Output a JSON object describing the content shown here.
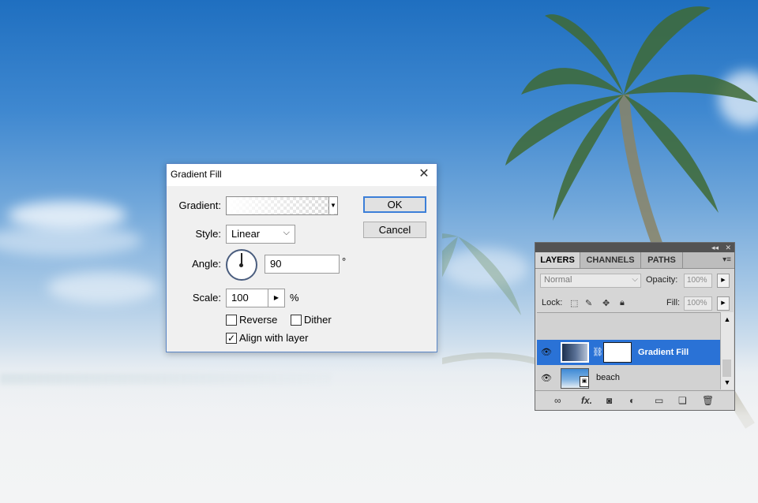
{
  "dialog": {
    "title": "Gradient Fill",
    "close_glyph": "✕",
    "gradient_label": "Gradient:",
    "style_label": "Style:",
    "style_value": "Linear",
    "angle_label": "Angle:",
    "angle_value": "90",
    "angle_unit": "°",
    "scale_label": "Scale:",
    "scale_value": "100",
    "scale_unit": "%",
    "reverse_label": "Reverse",
    "reverse_checked": false,
    "dither_label": "Dither",
    "dither_checked": false,
    "align_label": "Align with layer",
    "align_checked": true,
    "ok_label": "OK",
    "cancel_label": "Cancel"
  },
  "layers_panel": {
    "tabs": [
      "LAYERS",
      "CHANNELS",
      "PATHS"
    ],
    "active_tab": "LAYERS",
    "blend_mode": "Normal",
    "opacity_label": "Opacity:",
    "opacity_value": "100%",
    "lock_label": "Lock:",
    "fill_label": "Fill:",
    "fill_value": "100%",
    "layers": [
      {
        "name": "Gradient Fill",
        "selected": true,
        "visible": true
      },
      {
        "name": "beach",
        "selected": false,
        "visible": true
      }
    ],
    "footer_icons": [
      "link-layers-icon",
      "fx-icon",
      "add-mask-icon",
      "adjustment-layer-icon",
      "new-group-icon",
      "new-layer-icon",
      "trash-icon"
    ],
    "footer_fx": "fx."
  },
  "colors": {
    "selection": "#2a72d6",
    "dialog_accent": "#3c7fd8"
  }
}
